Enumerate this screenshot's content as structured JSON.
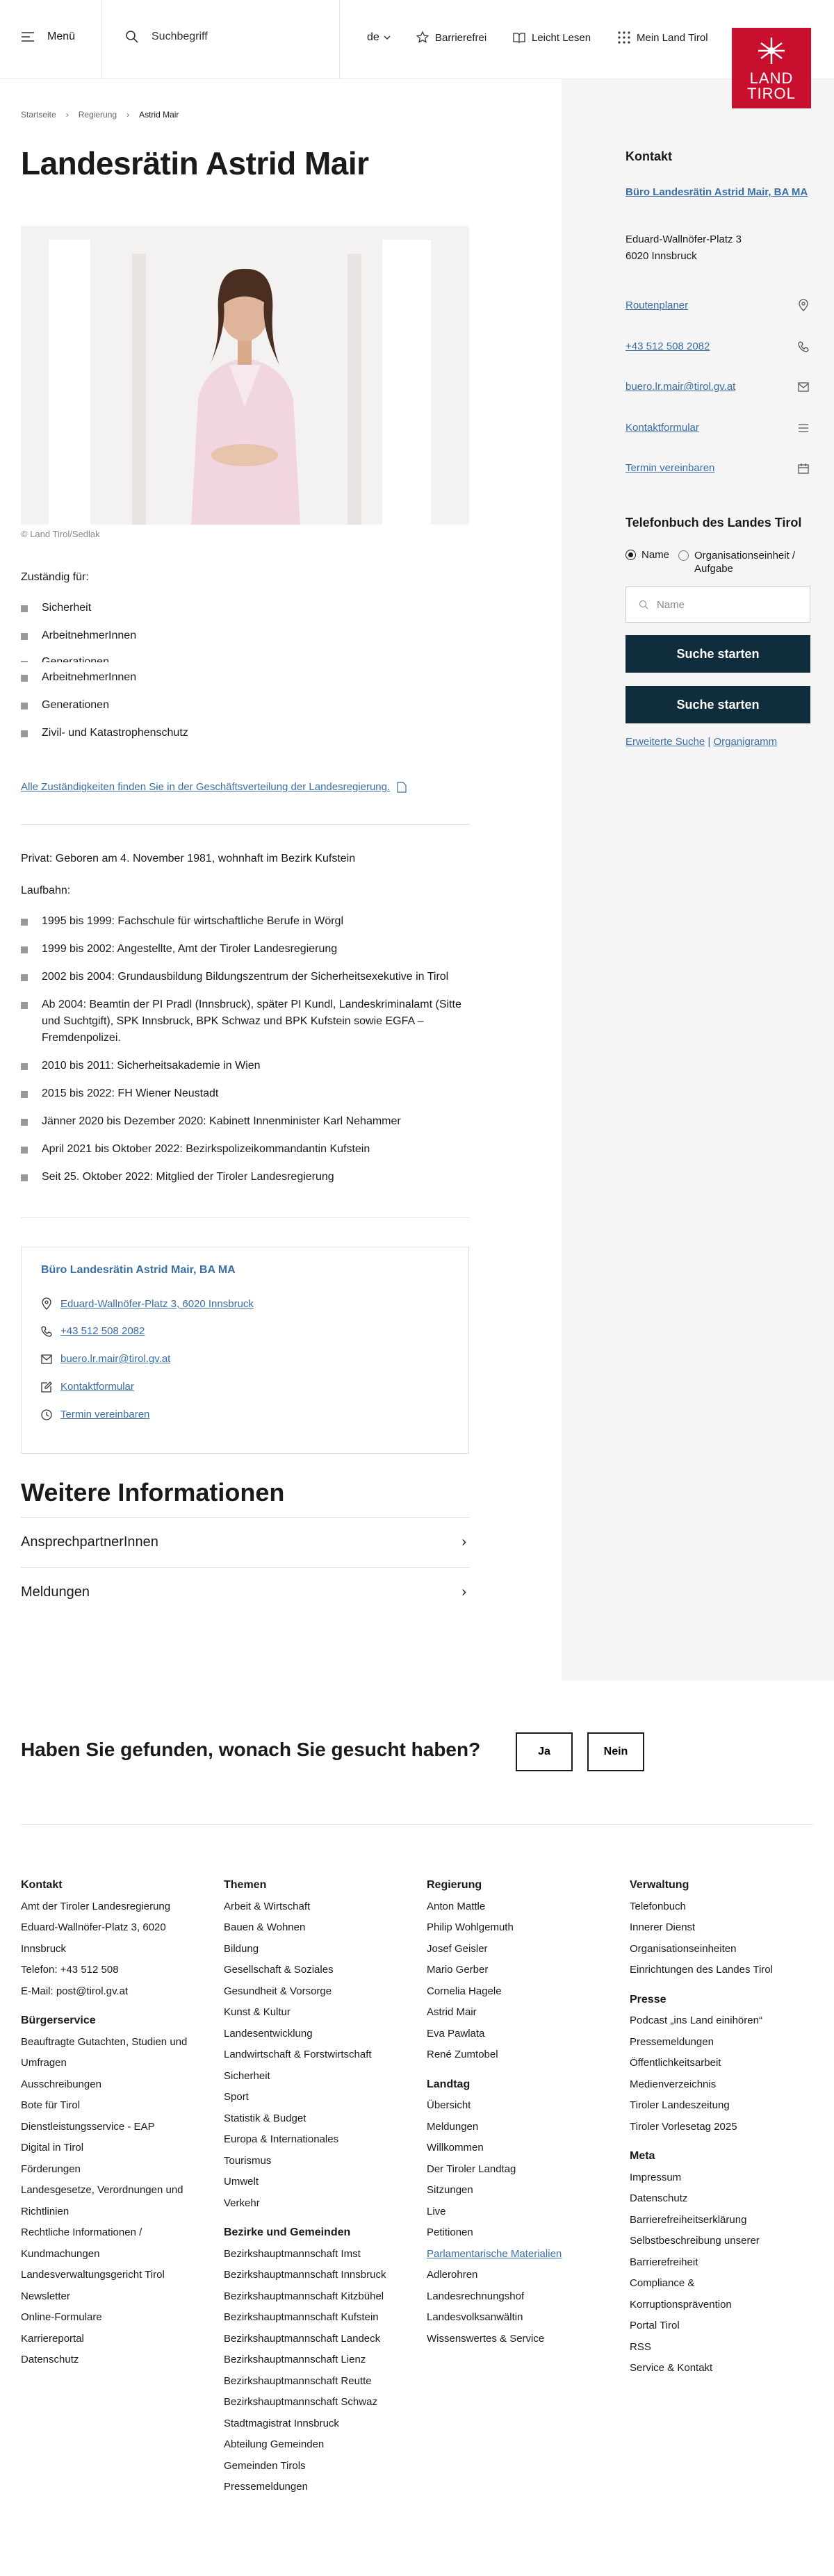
{
  "header": {
    "menu_label": "Menü",
    "search_placeholder": "Suchbegriff",
    "lang": "de",
    "barrierefrei": "Barrierefrei",
    "leicht_lesen": "Leicht Lesen",
    "mein_land": "Mein Land Tirol",
    "logo_line1": "LAND",
    "logo_line2": "TIROL"
  },
  "breadcrumb": [
    "Startseite",
    "Regierung",
    "Astrid Mair"
  ],
  "page_title": "Landesrätin Astrid Mair",
  "photo_credit": "© Land Tirol/Sedlak",
  "zustaendig_label": "Zuständig für:",
  "zustaendig_items": [
    "Sicherheit",
    "ArbeitnehmerInnen",
    "Generationen",
    "ArbeitnehmerInnen",
    "Generationen",
    "Zivil- und Katastrophenschutz"
  ],
  "alle_link": "Alle Zuständigkeiten finden Sie in der Geschäftsverteilung der Landesregierung.",
  "privat": "Privat: Geboren am 4. November 1981, wohnhaft im Bezirk Kufstein",
  "laufbahn_label": "Laufbahn:",
  "laufbahn": [
    "1995 bis 1999: Fachschule für wirtschaftliche Berufe in Wörgl",
    "1999 bis 2002: Angestellte, Amt der Tiroler Landesregierung",
    "2002 bis 2004: Grundausbildung Bildungszentrum der Sicherheitsexekutive in Tirol",
    "Ab 2004: Beamtin der PI Pradl (Innsbruck), später PI Kundl, Landeskriminalamt (Sitte und Suchtgift), SPK Innsbruck, BPK Schwaz und BPK Kufstein sowie EGFA – Fremdenpolizei.",
    "2010 bis 2011: Sicherheitsakademie in Wien",
    "2015 bis 2022: FH Wiener Neustadt",
    "Jänner 2020 bis Dezember 2020: Kabinett Innenminister Karl Nehammer",
    "April 2021 bis Oktober 2022: Bezirkspolizeikommandantin Kufstein",
    "Seit 25. Oktober 2022: Mitglied der Tiroler Landesregierung"
  ],
  "card": {
    "title": "Büro Landesrätin Astrid Mair, BA MA",
    "address": "Eduard-Wallnöfer-Platz 3, 6020 Innsbruck",
    "phone": "+43 512 508 2082",
    "email": "buero.lr.mair@tirol.gv.at",
    "form": "Kontaktformular",
    "termin": "Termin vereinbaren"
  },
  "weitere_title": "Weitere Informationen",
  "weitere_items": [
    "AnsprechpartnerInnen",
    "Meldungen"
  ],
  "sidebar": {
    "kontakt_title": "Kontakt",
    "office": "Büro Landesrätin Astrid Mair, BA MA",
    "street": "Eduard-Wallnöfer-Platz 3",
    "city": "6020 Innsbruck",
    "routenplaner": "Routenplaner",
    "phone": "+43 512 508 2082",
    "email": "buero.lr.mair@tirol.gv.at",
    "form": "Kontaktformular",
    "termin": "Termin vereinbaren",
    "tb_title": "Telefonbuch des Landes Tirol",
    "radio_name": "Name",
    "radio_org": "Organisationseinheit / Aufgabe",
    "name_placeholder": "Name",
    "btn1": "Suche starten",
    "btn2": "Suche starten",
    "erweitert": "Erweiterte Suche",
    "organigramm": "Organigramm"
  },
  "feedback": {
    "question": "Haben Sie gefunden, wonach Sie gesucht haben?",
    "yes": "Ja",
    "no": "Nein"
  },
  "footer": {
    "kontakt_h": "Kontakt",
    "kontakt": [
      "Amt der Tiroler Landesregierung",
      "Eduard-Wallnöfer-Platz 3, 6020",
      "Innsbruck",
      "Telefon: +43 512 508",
      "E-Mail: post@tirol.gv.at"
    ],
    "buerger_h": "Bürgerservice",
    "buerger": [
      "Beauftragte Gutachten, Studien und",
      "Umfragen",
      "Ausschreibungen",
      "Bote für Tirol",
      "Dienstleistungsservice - EAP",
      "Digital in Tirol",
      "Förderungen",
      "Landesgesetze, Verordnungen und",
      "Richtlinien",
      "Rechtliche Informationen /",
      "Kundmachungen",
      "Landesverwaltungsgericht Tirol",
      "Newsletter",
      "Online-Formulare",
      "Karriereportal",
      "Datenschutz"
    ],
    "themen_h": "Themen",
    "themen": [
      "Arbeit & Wirtschaft",
      "Bauen & Wohnen",
      "Bildung",
      "Gesellschaft & Soziales",
      "Gesundheit & Vorsorge",
      "Kunst & Kultur",
      "Landesentwicklung",
      "Landwirtschaft & Forstwirtschaft",
      "Sicherheit",
      "Sport",
      "Statistik & Budget",
      "Europa & Internationales",
      "Tourismus",
      "Umwelt",
      "Verkehr"
    ],
    "bezirke_h": "Bezirke und Gemeinden",
    "bezirke": [
      "Bezirkshauptmannschaft Imst",
      "Bezirkshauptmannschaft Innsbruck",
      "Bezirkshauptmannschaft Kitzbühel",
      "Bezirkshauptmannschaft Kufstein",
      "Bezirkshauptmannschaft Landeck",
      "Bezirkshauptmannschaft Lienz",
      "Bezirkshauptmannschaft Reutte",
      "Bezirkshauptmannschaft Schwaz",
      "Stadtmagistrat Innsbruck",
      "Abteilung Gemeinden",
      "Gemeinden Tirols",
      "Pressemeldungen"
    ],
    "regierung_h": "Regierung",
    "regierung": [
      "Anton Mattle",
      "Philip Wohlgemuth",
      "Josef Geisler",
      "Mario Gerber",
      "Cornelia Hagele",
      "Astrid Mair",
      "Eva Pawlata",
      "René Zumtobel"
    ],
    "landtag_h": "Landtag",
    "landtag": [
      "Übersicht",
      "Meldungen",
      "Willkommen",
      "Der Tiroler Landtag",
      "Sitzungen",
      "Live",
      "Petitionen",
      "Parlamentarische Materialien",
      "Adlerohren",
      "Landesrechnungshof",
      "Landesvolksanwältin",
      "Wissenswertes & Service"
    ],
    "verwaltung_h": "Verwaltung",
    "verwaltung": [
      "Telefonbuch",
      "Innerer Dienst",
      "Organisationseinheiten",
      "Einrichtungen des Landes Tirol"
    ],
    "presse_h": "Presse",
    "presse": [
      "Podcast „ins Land einihören“",
      "Pressemeldungen",
      "Öffentlichkeitsarbeit",
      "Medienverzeichnis",
      "Tiroler Landeszeitung",
      "Tiroler Vorlesetag 2025"
    ],
    "meta_h": "Meta",
    "meta": [
      "Impressum",
      "Datenschutz",
      "Barrierefreiheitserklärung",
      "Selbstbeschreibung unserer",
      "Barrierefreiheit",
      "Compliance &",
      "Korruptionsprävention",
      "Portal Tirol",
      "RSS",
      "Service & Kontakt"
    ]
  },
  "colors": {
    "brand_red": "#c8102e",
    "link_blue": "#3a6ea5",
    "dark_button": "#0f2d3c",
    "sidebar_bg": "#f5f5f5"
  }
}
